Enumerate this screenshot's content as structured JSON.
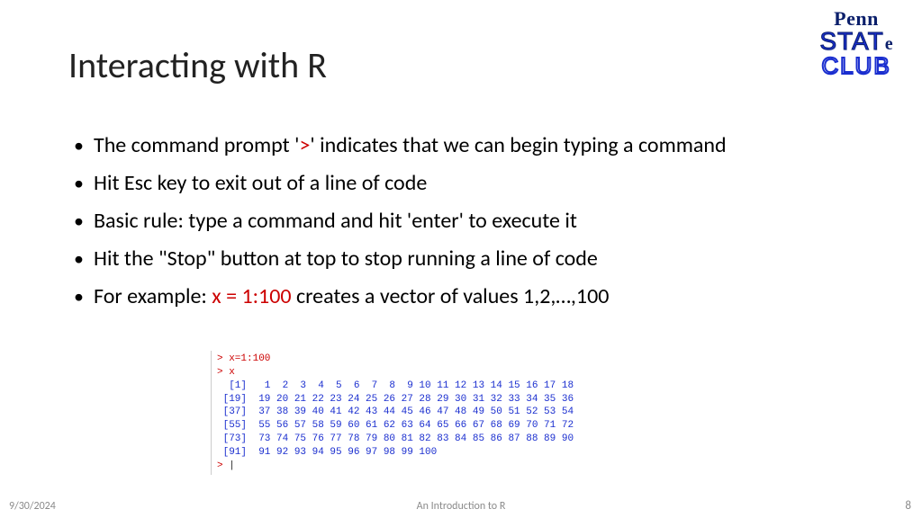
{
  "title": "Interacting with R",
  "logo": {
    "l1": "Penn",
    "l2": "STAT",
    "l2e": "e",
    "l3": "CLUB"
  },
  "bullets": {
    "b1a": "The command prompt '",
    "b1b": ">",
    "b1c": "' indicates that we can begin typing a command",
    "b2": "Hit Esc key to exit out of a line of code",
    "b3": "Basic rule: type a command and hit 'enter' to execute it",
    "b4": "Hit the \"Stop\" button at top to stop running a line of code",
    "b5a": "For example: ",
    "b5b": "x = 1:100",
    "b5c": " creates a vector of values 1,2,…,100"
  },
  "console": {
    "l1": "> x=1:100",
    "l2": "> x",
    "l3": "  [1]   1  2  3  4  5  6  7  8  9 10 11 12 13 14 15 16 17 18",
    "l4": " [19]  19 20 21 22 23 24 25 26 27 28 29 30 31 32 33 34 35 36",
    "l5": " [37]  37 38 39 40 41 42 43 44 45 46 47 48 49 50 51 52 53 54",
    "l6": " [55]  55 56 57 58 59 60 61 62 63 64 65 66 67 68 69 70 71 72",
    "l7": " [73]  73 74 75 76 77 78 79 80 81 82 83 84 85 86 87 88 89 90",
    "l8": " [91]  91 92 93 94 95 96 97 98 99 100",
    "l9a": "> ",
    "l9b": "|"
  },
  "footer": {
    "date": "9/30/2024",
    "title": "An Introduction to R",
    "page": "8"
  }
}
